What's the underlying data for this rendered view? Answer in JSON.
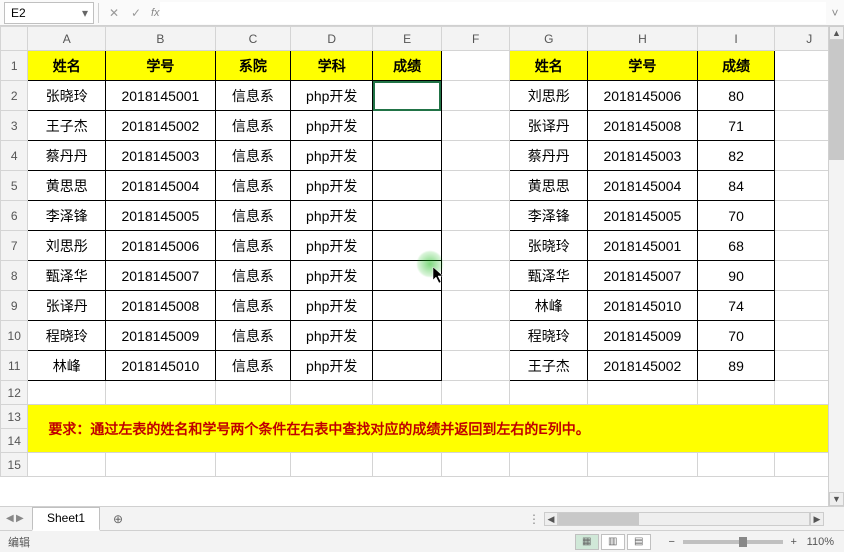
{
  "formula_bar": {
    "cell_ref": "E2",
    "cancel_glyph": "✕",
    "confirm_glyph": "✓",
    "fx_label": "fx",
    "formula_value": "",
    "expand_glyph": "˅",
    "dropdown_glyph": "▾"
  },
  "columns": [
    "A",
    "B",
    "C",
    "D",
    "E",
    "F",
    "G",
    "H",
    "I",
    "J"
  ],
  "row_count": 15,
  "left_table": {
    "headers": [
      "姓名",
      "学号",
      "系院",
      "学科",
      "成绩"
    ],
    "rows": [
      [
        "张晓玲",
        "2018145001",
        "信息系",
        "php开发",
        ""
      ],
      [
        "王子杰",
        "2018145002",
        "信息系",
        "php开发",
        ""
      ],
      [
        "蔡丹丹",
        "2018145003",
        "信息系",
        "php开发",
        ""
      ],
      [
        "黄思思",
        "2018145004",
        "信息系",
        "php开发",
        ""
      ],
      [
        "李泽锋",
        "2018145005",
        "信息系",
        "php开发",
        ""
      ],
      [
        "刘思彤",
        "2018145006",
        "信息系",
        "php开发",
        ""
      ],
      [
        "甄泽华",
        "2018145007",
        "信息系",
        "php开发",
        ""
      ],
      [
        "张译丹",
        "2018145008",
        "信息系",
        "php开发",
        ""
      ],
      [
        "程晓玲",
        "2018145009",
        "信息系",
        "php开发",
        ""
      ],
      [
        "林峰",
        "2018145010",
        "信息系",
        "php开发",
        ""
      ]
    ]
  },
  "right_table": {
    "headers": [
      "姓名",
      "学号",
      "成绩"
    ],
    "rows": [
      [
        "刘思彤",
        "2018145006",
        "80"
      ],
      [
        "张译丹",
        "2018145008",
        "71"
      ],
      [
        "蔡丹丹",
        "2018145003",
        "82"
      ],
      [
        "黄思思",
        "2018145004",
        "84"
      ],
      [
        "李泽锋",
        "2018145005",
        "70"
      ],
      [
        "张晓玲",
        "2018145001",
        "68"
      ],
      [
        "甄泽华",
        "2018145007",
        "90"
      ],
      [
        "林峰",
        "2018145010",
        "74"
      ],
      [
        "程晓玲",
        "2018145009",
        "70"
      ],
      [
        "王子杰",
        "2018145002",
        "89"
      ]
    ]
  },
  "note": "要求：通过左表的姓名和学号两个条件在右表中查找对应的成绩并返回到左右的E列中。",
  "tabs": {
    "active": "Sheet1",
    "add_glyph": "⊕"
  },
  "status": {
    "mode": "编辑",
    "zoom": "110%",
    "minus": "−",
    "plus": "+",
    "views": {
      "normal": "▦",
      "layout": "▥",
      "pagebreak": "▤"
    }
  },
  "scroll": {
    "left": "◀",
    "right": "▶",
    "up": "▲",
    "down": "▼"
  },
  "col_widths": {
    "row": 24,
    "A": 68,
    "B": 96,
    "C": 66,
    "D": 72,
    "E": 60,
    "F": 60,
    "G": 68,
    "H": 96,
    "I": 68,
    "J": 60
  }
}
